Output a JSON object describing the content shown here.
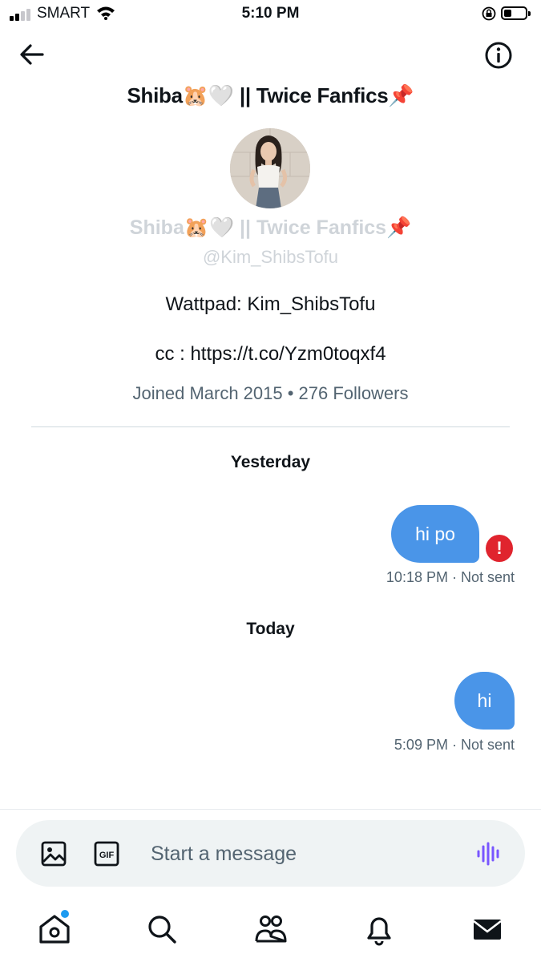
{
  "status_bar": {
    "carrier": "SMART",
    "time": "5:10 PM"
  },
  "header": {
    "title": "Shiba🐹🤍 || Twice Fanfics📌"
  },
  "profile": {
    "display_name": "Shiba🐹🤍 || Twice Fanfics📌",
    "handle": "@Kim_ShibsTofu",
    "bio_line1": "Wattpad: Kim_ShibsTofu",
    "bio_line2": "cc : https://t.co/Yzm0toqxf4",
    "meta": "Joined March 2015 • 276 Followers"
  },
  "conversation": {
    "day1": "Yesterday",
    "message1": {
      "text": "hi po",
      "meta": "10:18 PM · Not sent",
      "error_mark": "!"
    },
    "day2": "Today",
    "message2": {
      "text": "hi",
      "meta": "5:09 PM · Not sent"
    }
  },
  "composer": {
    "placeholder": "Start a message",
    "gif_label": "GIF"
  },
  "colors": {
    "accent": "#1d9bf0",
    "bubble": "#4a95e8",
    "error": "#e0242e",
    "voice": "#7856ff"
  },
  "icons": {
    "back": "arrow-left-icon",
    "info": "info-icon",
    "image": "image-icon",
    "gif": "gif-icon",
    "voice": "voice-waveform-icon",
    "nav": [
      "home-icon",
      "search-icon",
      "communities-icon",
      "bell-icon",
      "mail-icon"
    ]
  }
}
